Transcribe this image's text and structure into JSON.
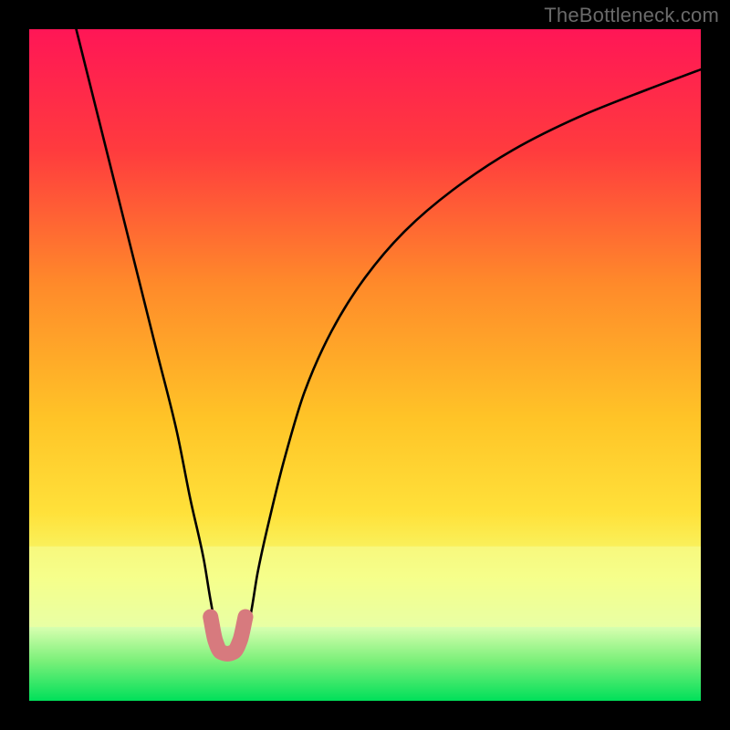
{
  "attribution": "TheBottleneck.com",
  "chart_data": {
    "type": "line",
    "title": "",
    "xlabel": "",
    "ylabel": "",
    "xlim": [
      0,
      100
    ],
    "ylim": [
      0,
      100
    ],
    "grid": false,
    "legend": false,
    "background_gradient": {
      "top_color": "#ff1656",
      "mid_color": "#ffd830",
      "bottom_color": "#00e05a"
    },
    "background_highlight_band": {
      "color_approx": "#f6ff9a",
      "y_range": [
        11,
        23
      ]
    },
    "series": [
      {
        "name": "main-curve",
        "color": "#000000",
        "x": [
          7,
          10,
          13,
          16,
          19,
          22,
          24,
          26,
          27,
          28,
          29.5,
          31,
          32,
          33,
          34,
          36,
          38,
          41,
          45,
          50,
          56,
          63,
          72,
          82,
          92,
          100
        ],
        "y": [
          100,
          88,
          76,
          64,
          52,
          40,
          30,
          21,
          15,
          10,
          7,
          7,
          9,
          13,
          19,
          28,
          36,
          46,
          55,
          63,
          70,
          76,
          82,
          87,
          91,
          94
        ]
      },
      {
        "name": "highlight-segment",
        "color": "#d77a7e",
        "x": [
          27.0,
          27.7,
          28.5,
          29.5,
          30.5,
          31.4,
          32.2
        ],
        "y": [
          12.5,
          9.0,
          7.3,
          7.0,
          7.3,
          9.0,
          12.5
        ]
      }
    ],
    "annotations": []
  }
}
